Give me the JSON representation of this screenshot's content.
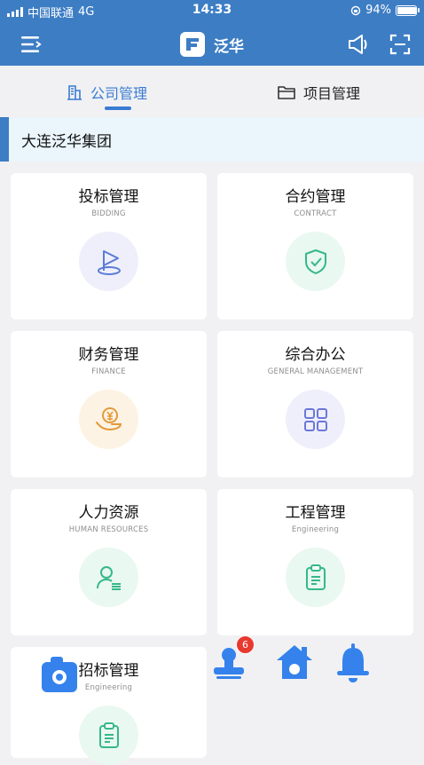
{
  "status_bar": {
    "carrier": "中国联通",
    "network": "4G",
    "time": "14:33",
    "battery": "94%",
    "battery_level": 0.94
  },
  "nav": {
    "app_name": "泛华",
    "icons": [
      "menu-icon",
      "app-logo",
      "speaker-icon",
      "scan-icon"
    ]
  },
  "tabs": [
    {
      "label": "公司管理",
      "icon": "building-icon",
      "active": true
    },
    {
      "label": "项目管理",
      "icon": "folder-icon",
      "active": false
    }
  ],
  "group_name": "大连泛华集团",
  "modules": [
    {
      "title": "投标管理",
      "subtitle": "BIDDING",
      "icon": "flag-icon"
    },
    {
      "title": "合约管理",
      "subtitle": "CONTRACT",
      "icon": "shield-check-icon"
    },
    {
      "title": "财务管理",
      "subtitle": "FINANCE",
      "icon": "yuan-hand-icon"
    },
    {
      "title": "综合办公",
      "subtitle": "GENERAL MANAGEMENT",
      "icon": "grid-icon"
    },
    {
      "title": "人力资源",
      "subtitle": "HUMAN RESOURCES",
      "icon": "person-list-icon"
    },
    {
      "title": "工程管理",
      "subtitle": "Engineering",
      "icon": "clipboard-icon"
    },
    {
      "title": "招标管理",
      "subtitle": "Engineering",
      "icon": "clipboard-icon"
    }
  ],
  "floating_actions": {
    "stamp_badge": "6",
    "icons": [
      "camera-icon",
      "stamp-icon",
      "home-icon",
      "bell-icon"
    ]
  },
  "colors": {
    "header": "#3d7dc4",
    "accent": "#3a7cd2",
    "badge": "#e8392f"
  }
}
